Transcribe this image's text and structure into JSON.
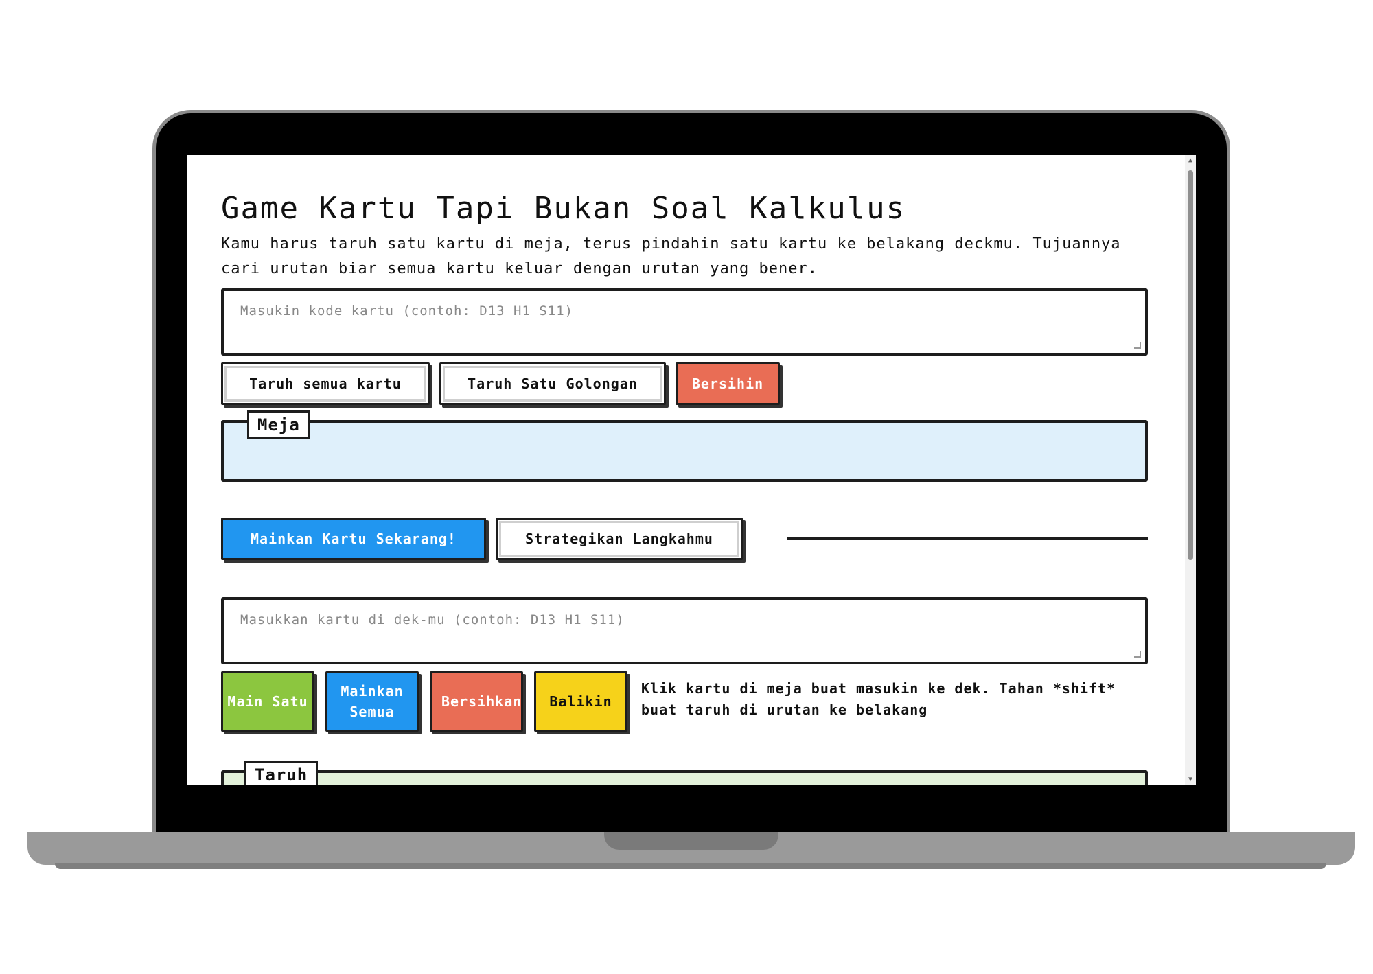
{
  "page": {
    "title": "Game Kartu Tapi Bukan Soal Kalkulus",
    "description": "Kamu harus taruh satu kartu di meja, terus pindahin satu kartu ke belakang deckmu. Tujuannya cari urutan biar semua kartu keluar dengan urutan yang bener."
  },
  "table_section": {
    "input_placeholder": "Masukin kode kartu (contoh: D13 H1 S11)",
    "buttons": {
      "place_all": "Taruh semua kartu",
      "place_group": "Taruh Satu Golongan",
      "clear": "Bersihin"
    },
    "legend": "Meja"
  },
  "mode_buttons": {
    "play_now": "Mainkan Kartu Sekarang!",
    "strategize": "Strategikan Langkahmu"
  },
  "deck_section": {
    "input_placeholder": "Masukkan kartu di dek-mu (contoh: D13 H1 S11)",
    "buttons": {
      "play_one": "Main Satu",
      "play_all": "Mainkan Semua",
      "clear": "Bersihkan",
      "reverse": "Balikin"
    },
    "hint": "Klik kartu di meja buat masukin ke dek. Tahan *shift* buat taruh di urutan ke belakang",
    "legend": "Taruh"
  },
  "colors": {
    "red": "#e96d55",
    "blue": "#2196f0",
    "green": "#8cc63f",
    "yellow": "#f6d21a",
    "table_bg": "#dff0fb",
    "drop_bg": "#e3f1da"
  },
  "scrollbar": {
    "position_fraction": 0.0
  }
}
